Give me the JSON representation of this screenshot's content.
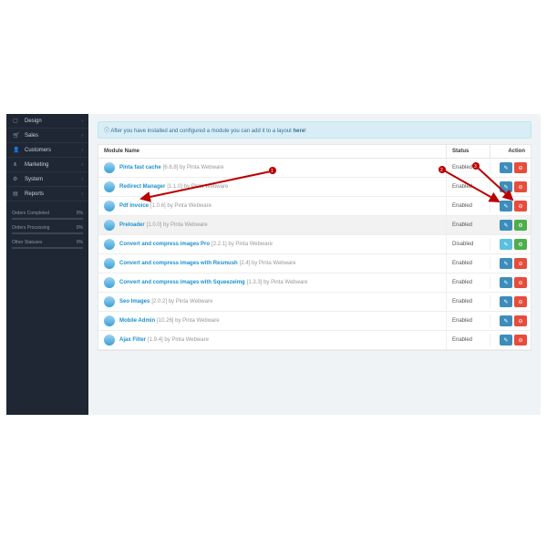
{
  "sidebar": {
    "items": [
      {
        "icon": "▢",
        "label": "Design"
      },
      {
        "icon": "🛒",
        "label": "Sales"
      },
      {
        "icon": "👤",
        "label": "Customers"
      },
      {
        "icon": "⋔",
        "label": "Marketing"
      },
      {
        "icon": "⚙",
        "label": "System"
      },
      {
        "icon": "▤",
        "label": "Reports"
      }
    ],
    "stats": [
      {
        "label": "Orders Completed",
        "val": "0%"
      },
      {
        "label": "Orders Processing",
        "val": "0%"
      },
      {
        "label": "Other Statuses",
        "val": "0%"
      }
    ]
  },
  "alert": {
    "pre": "After you have installed and configured a module you can add it to a layout ",
    "link": "here",
    "post": "!"
  },
  "th": {
    "name": "Module Name",
    "status": "Status",
    "action": "Action"
  },
  "modules": [
    {
      "name": "Pinta fast cache",
      "meta": "[6.6.8] by Pinta Webware",
      "status": "Enabled",
      "b1": "blue",
      "b2": "red"
    },
    {
      "name": "Redirect Manager",
      "meta": "[1.1.0] by Pinta Webware",
      "status": "Enabled",
      "b1": "blue",
      "b2": "red"
    },
    {
      "name": "Pdf Invoice",
      "meta": "[1.0.6] by Pinta Webware",
      "status": "Enabled",
      "b1": "blue",
      "b2": "red"
    },
    {
      "name": "Preloader",
      "meta": "[1.0.0] by Pinta Webware",
      "status": "Enabled",
      "b1": "blue",
      "b2": "grn",
      "hl": true
    },
    {
      "name": "Convert and compress images Pro",
      "meta": "[2.2.1] by Pinta Webware",
      "status": "Disabled",
      "b1": "lblue",
      "b2": "grn"
    },
    {
      "name": "Convert and compress images with Resmush",
      "meta": "[2.4] by Pinta Webware",
      "status": "Enabled",
      "b1": "blue",
      "b2": "red"
    },
    {
      "name": "Convert and compress images with Squeezeimg",
      "meta": "[1.3.3] by Pinta Webware",
      "status": "Enabled",
      "b1": "blue",
      "b2": "red"
    },
    {
      "name": "Seo Images",
      "meta": "[2.0.2] by Pinta Webware",
      "status": "Enabled",
      "b1": "blue",
      "b2": "red"
    },
    {
      "name": "Mobile Admin",
      "meta": "[10.26] by Pinta Webware",
      "status": "Enabled",
      "b1": "blue",
      "b2": "red"
    },
    {
      "name": "Ajax Filter",
      "meta": "[1.9.4] by Pinta Webware",
      "status": "Enabled",
      "b1": "blue",
      "b2": "red"
    }
  ],
  "callouts": [
    "1",
    "2",
    "3"
  ]
}
